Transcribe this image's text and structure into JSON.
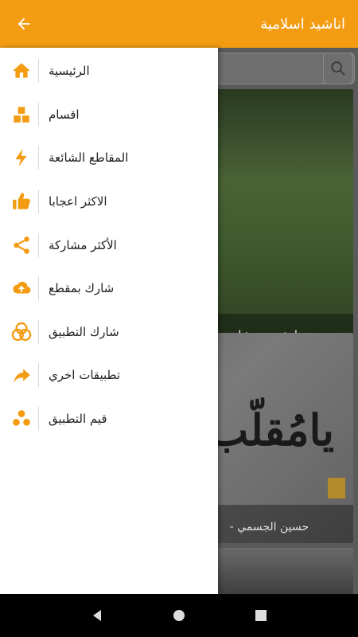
{
  "appbar": {
    "title": "اناشيد اسلامية",
    "back_icon": "arrow-left-icon"
  },
  "content": {
    "cards": [
      {
        "caption": "انشودة مشاري"
      },
      {
        "calligraphy": "يامُقلّب ال",
        "caption": "حسين الجسمي - "
      },
      {
        "caption": ""
      }
    ]
  },
  "drawer": {
    "items": [
      {
        "label": "الرئيسية",
        "icon": "home-icon"
      },
      {
        "label": "اقسام",
        "icon": "sections-icon"
      },
      {
        "label": "المقاطع الشائعة",
        "icon": "bolt-icon"
      },
      {
        "label": "الاكثر اعجابا",
        "icon": "thumbs-up-icon"
      },
      {
        "label": "الأكثر مشاركة",
        "icon": "share-icon"
      },
      {
        "label": "شارك بمقطع",
        "icon": "cloud-upload-icon"
      },
      {
        "label": "شارك التطبيق",
        "icon": "share-app-icon"
      },
      {
        "label": "تطبيقات اخري",
        "icon": "forward-icon"
      },
      {
        "label": "قيم التطبيق",
        "icon": "rate-icon"
      }
    ]
  },
  "colors": {
    "accent": "#f39c12",
    "drawer_bg": "#ffffff",
    "text": "#222222"
  }
}
